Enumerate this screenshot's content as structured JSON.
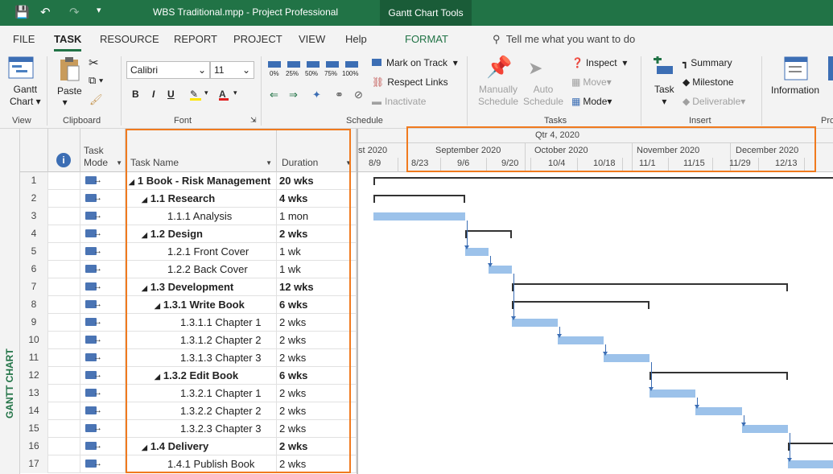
{
  "titlebar": {
    "title": "WBS Traditional.mpp  -  Project Professional",
    "tools": "Gantt Chart Tools"
  },
  "tabs": [
    "FILE",
    "TASK",
    "RESOURCE",
    "REPORT",
    "PROJECT",
    "VIEW",
    "Help",
    "FORMAT"
  ],
  "tell_me": "Tell me what you want to do",
  "ribbon": {
    "view": {
      "button": "Gantt",
      "button2": "Chart",
      "group": "View"
    },
    "clipboard": {
      "paste": "Paste",
      "group": "Clipboard"
    },
    "font": {
      "family": "Calibri",
      "size": "11",
      "bold": "B",
      "italic": "I",
      "underline": "U",
      "group": "Font"
    },
    "schedule": {
      "percents": [
        "0%",
        "25%",
        "50%",
        "75%",
        "100%"
      ],
      "mark_on_track": "Mark on Track",
      "respect_links": "Respect Links",
      "inactivate": "Inactivate",
      "group": "Schedule"
    },
    "tasks": {
      "manually": "Manually",
      "schedule1": "Schedule",
      "auto": "Auto",
      "schedule2": "Schedule",
      "inspect": "Inspect",
      "move": "Move",
      "mode": "Mode",
      "group": "Tasks"
    },
    "insert": {
      "task": "Task",
      "summary": "Summary",
      "milestone": "Milestone",
      "deliverable": "Deliverable",
      "group": "Insert"
    },
    "properties": {
      "information": "Information",
      "group": "Pro"
    }
  },
  "sidebar_label": "GANTT CHART",
  "columns": {
    "task_mode": "Task",
    "task_mode2": "Mode",
    "task_name": "Task Name",
    "duration": "Duration"
  },
  "timeline": {
    "quarter": "Qtr 4, 2020",
    "months": [
      "st 2020",
      "September 2020",
      "October 2020",
      "November 2020",
      "December 2020"
    ],
    "weeks": [
      "8/9",
      "8/23",
      "9/6",
      "9/20",
      "10/4",
      "10/18",
      "11/1",
      "11/15",
      "11/29",
      "12/13"
    ]
  },
  "tasks": [
    {
      "id": "1",
      "name": "1 Book - Risk Management",
      "duration": "20 wks",
      "level": 0,
      "summary": true
    },
    {
      "id": "2",
      "name": "1.1 Research",
      "duration": "4 wks",
      "level": 1,
      "summary": true
    },
    {
      "id": "3",
      "name": "1.1.1 Analysis",
      "duration": "1 mon",
      "level": 2,
      "summary": false
    },
    {
      "id": "4",
      "name": "1.2 Design",
      "duration": "2 wks",
      "level": 1,
      "summary": true
    },
    {
      "id": "5",
      "name": "1.2.1 Front Cover",
      "duration": "1 wk",
      "level": 2,
      "summary": false
    },
    {
      "id": "6",
      "name": "1.2.2 Back Cover",
      "duration": "1 wk",
      "level": 2,
      "summary": false
    },
    {
      "id": "7",
      "name": "1.3 Development",
      "duration": "12 wks",
      "level": 1,
      "summary": true
    },
    {
      "id": "8",
      "name": "1.3.1 Write Book",
      "duration": "6 wks",
      "level": 2,
      "summary": true
    },
    {
      "id": "9",
      "name": "1.3.1.1 Chapter 1",
      "duration": "2 wks",
      "level": 3,
      "summary": false
    },
    {
      "id": "10",
      "name": "1.3.1.2 Chapter 2",
      "duration": "2 wks",
      "level": 3,
      "summary": false
    },
    {
      "id": "11",
      "name": "1.3.1.3 Chapter 3",
      "duration": "2 wks",
      "level": 3,
      "summary": false
    },
    {
      "id": "12",
      "name": "1.3.2 Edit Book",
      "duration": "6 wks",
      "level": 2,
      "summary": true
    },
    {
      "id": "13",
      "name": "1.3.2.1 Chapter 1",
      "duration": "2 wks",
      "level": 3,
      "summary": false
    },
    {
      "id": "14",
      "name": "1.3.2.2 Chapter 2",
      "duration": "2 wks",
      "level": 3,
      "summary": false
    },
    {
      "id": "15",
      "name": "1.3.2.3 Chapter 3",
      "duration": "2 wks",
      "level": 3,
      "summary": false
    },
    {
      "id": "16",
      "name": "1.4 Delivery",
      "duration": "2 wks",
      "level": 1,
      "summary": true
    },
    {
      "id": "17",
      "name": "1.4.1 Publish Book",
      "duration": "2 wks",
      "level": 2,
      "summary": false
    }
  ]
}
